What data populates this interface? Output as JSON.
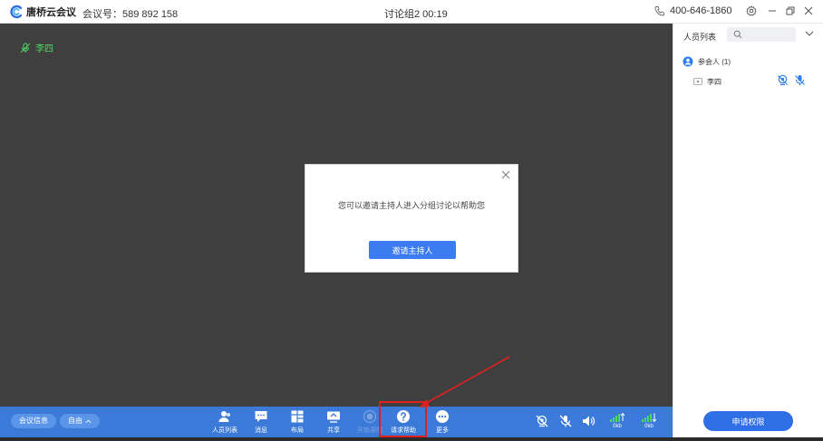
{
  "app": {
    "name": "唐桥云会议",
    "meeting_id_label": "会议号：589 892 158",
    "window_title": "讨论组2 00:19",
    "phone": "400-646-1860"
  },
  "stage": {
    "participant_name": "李四"
  },
  "dialog": {
    "message": "您可以邀请主持人进入分组讨论以帮助您",
    "button_label": "邀请主持人"
  },
  "toolbar": {
    "meeting_info": "会议信息",
    "free_mode": "自由",
    "items": [
      {
        "label": "人员列表",
        "icon": "people-icon"
      },
      {
        "label": "消息",
        "icon": "chat-icon"
      },
      {
        "label": "布局",
        "icon": "layout-icon"
      },
      {
        "label": "共享",
        "icon": "share-screen-icon"
      },
      {
        "label": "开始录制",
        "icon": "record-icon"
      },
      {
        "label": "请求帮助",
        "icon": "help-icon"
      },
      {
        "label": "更多",
        "icon": "more-icon"
      }
    ],
    "upload_rate": "0kb",
    "download_rate": "0kb"
  },
  "sidepanel": {
    "title": "人员列表",
    "search_placeholder": "",
    "group_label": "参会人 (1)",
    "members": [
      {
        "name": "李四"
      }
    ],
    "apply_button": "申请权限"
  },
  "colors": {
    "toolbar_bg": "#3b7ad9",
    "accent": "#3b7cf0",
    "stage_bg": "#3f3f3f",
    "highlight": "#e02020",
    "speaking": "#4cd964"
  }
}
